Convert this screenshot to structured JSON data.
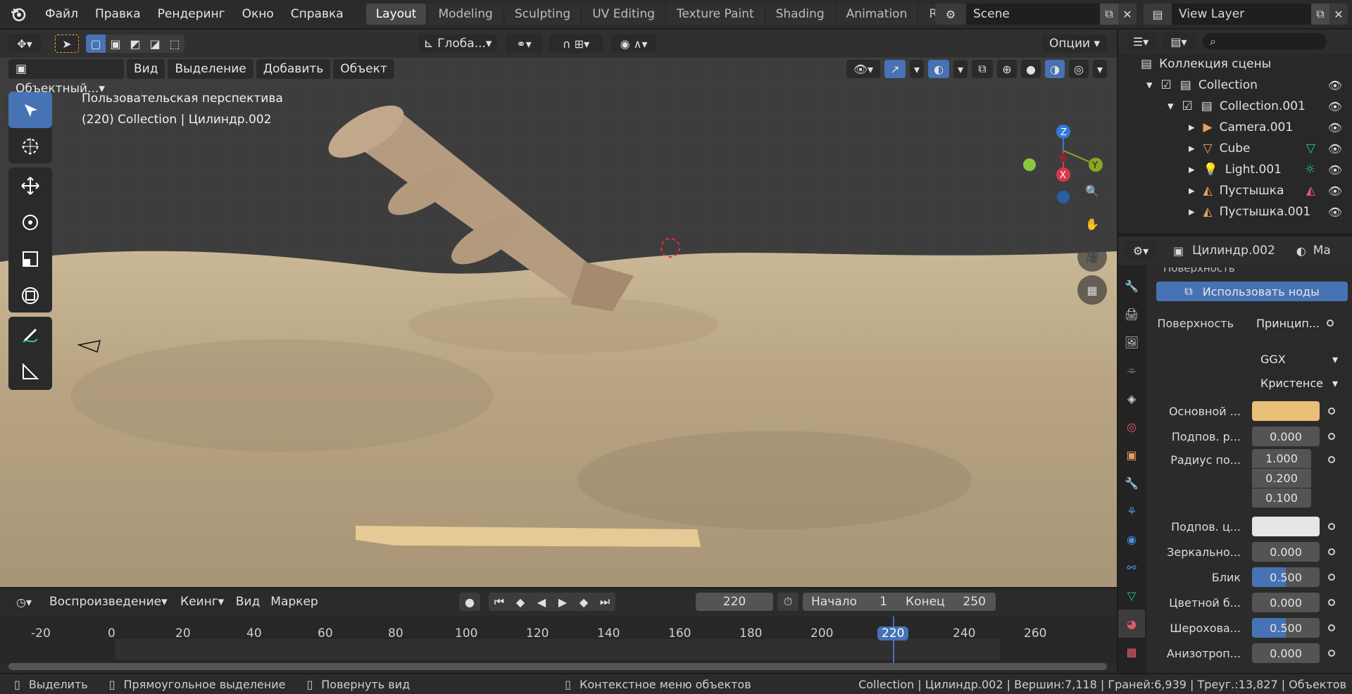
{
  "topbar": {
    "menus": [
      "Файл",
      "Правка",
      "Рендеринг",
      "Окно",
      "Справка"
    ],
    "workspaces": [
      "Layout",
      "Modeling",
      "Sculpting",
      "UV Editing",
      "Texture Paint",
      "Shading",
      "Animation",
      "Rendering"
    ],
    "active_workspace": "Layout",
    "scene": "Scene",
    "view_layer": "View Layer"
  },
  "viewport_header": {
    "orientation": "Глоба...",
    "options": "Опции",
    "mode": "Объектный...",
    "menus": [
      "Вид",
      "Выделение",
      "Добавить",
      "Объект"
    ]
  },
  "viewport": {
    "perspective": "Пользовательская перспектива",
    "info": "(220) Collection | Цилиндр.002",
    "gizmo": {
      "z": "Z",
      "y": "Y",
      "x": "X"
    }
  },
  "outliner": {
    "title": "Коллекция сцены",
    "items": [
      {
        "label": "Collection",
        "icon": "collection-icon"
      },
      {
        "label": "Collection.001",
        "icon": "collection-icon"
      },
      {
        "label": "Camera.001",
        "icon": "camera-icon"
      },
      {
        "label": "Cube",
        "icon": "mesh-icon"
      },
      {
        "label": "Light.001",
        "icon": "light-icon"
      },
      {
        "label": "Пустышка",
        "icon": "empty-icon"
      },
      {
        "label": "Пустышка.001",
        "icon": "empty-icon"
      }
    ]
  },
  "properties": {
    "object": "Цилиндр.002",
    "material_tab": "Ма",
    "section": "Поверхность",
    "use_nodes": "Использовать ноды",
    "surface_label": "Поверхность",
    "surface_value": "Принцип...",
    "distribution": "GGX",
    "subsurface_method": "Кристенсе",
    "fields": [
      {
        "label": "Основной ...",
        "value": "",
        "color": "#e9bf77"
      },
      {
        "label": "Подпов. р...",
        "value": "0.000"
      },
      {
        "label": "Радиус по...",
        "values": [
          "1.000",
          "0.200",
          "0.100"
        ]
      },
      {
        "label": "Подпов. ц...",
        "value": "",
        "color": "#e6e6e6"
      },
      {
        "label": "Зеркально...",
        "value": "0.000"
      },
      {
        "label": "Блик",
        "value": "0.500",
        "fill": 0.5
      },
      {
        "label": "Цветной б...",
        "value": "0.000"
      },
      {
        "label": "Шерохова...",
        "value": "0.500",
        "fill": 0.5
      },
      {
        "label": "Анизотроп...",
        "value": "0.000"
      }
    ]
  },
  "timeline": {
    "playback": "Воспроизведение",
    "keying": "Кеинг",
    "view": "Вид",
    "marker": "Маркер",
    "current_frame": "220",
    "start_label": "Начало",
    "start": "1",
    "end_label": "Конец",
    "end": "250",
    "ticks": [
      "-20",
      "0",
      "20",
      "40",
      "60",
      "80",
      "100",
      "120",
      "140",
      "160",
      "180",
      "200",
      "220",
      "240",
      "260"
    ]
  },
  "status": {
    "select": "Выделить",
    "box_select": "Прямоугольное выделение",
    "rotate_view": "Повернуть вид",
    "context_menu": "Контекстное меню объектов",
    "stats": "Collection | Цилиндр.002 | Вершин:7,118 | Граней:6,939 | Треуг.:13,827 | Объектов"
  },
  "colors": {
    "accent": "#4772b3",
    "base_color": "#e9bf77",
    "sand": "#cbb898"
  }
}
